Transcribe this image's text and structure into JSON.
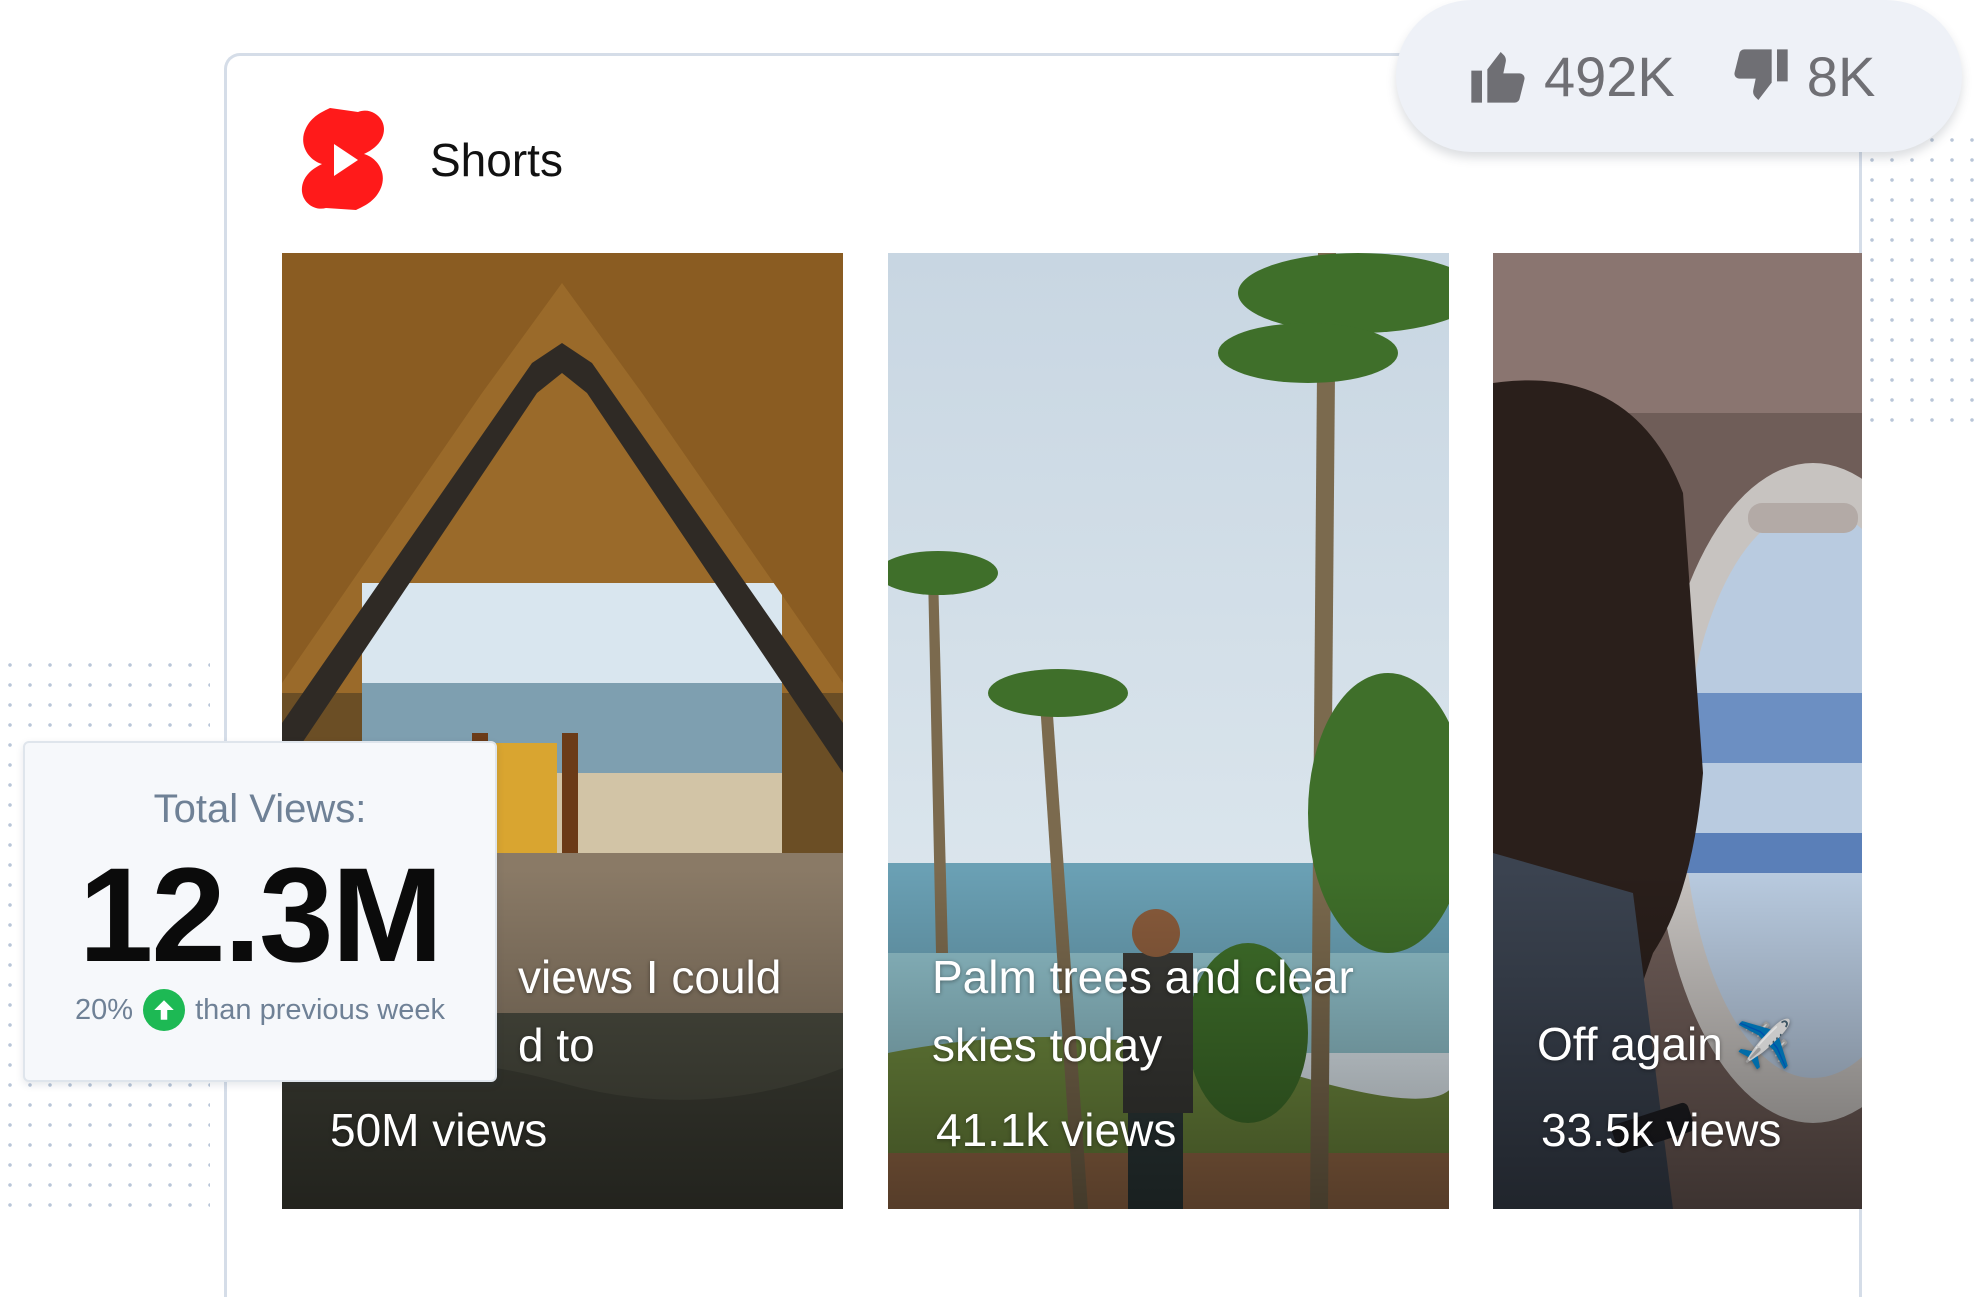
{
  "brand": {
    "title": "Shorts",
    "logo_icon": "youtube-shorts-logo-icon",
    "logo_color": "#ff0000"
  },
  "reactions": {
    "likes": {
      "icon": "thumbs-up-icon",
      "count": "492K"
    },
    "dislikes": {
      "icon": "thumbs-down-icon",
      "count": "8K"
    }
  },
  "stats": {
    "label": "Total Views:",
    "value": "12.3M",
    "change_percent": "20%",
    "change_icon": "arrow-up-icon",
    "change_text": "than previous week",
    "change_color": "#1db954"
  },
  "shorts": [
    {
      "caption_line1": "views I could",
      "caption_line2": "d to",
      "views": "50M views"
    },
    {
      "caption_line1": "Palm trees and clear",
      "caption_line2": "skies today",
      "views": "41.1k views"
    },
    {
      "caption_line1": "Off again ✈️",
      "caption_line2": "",
      "views": "33.5k views"
    }
  ]
}
